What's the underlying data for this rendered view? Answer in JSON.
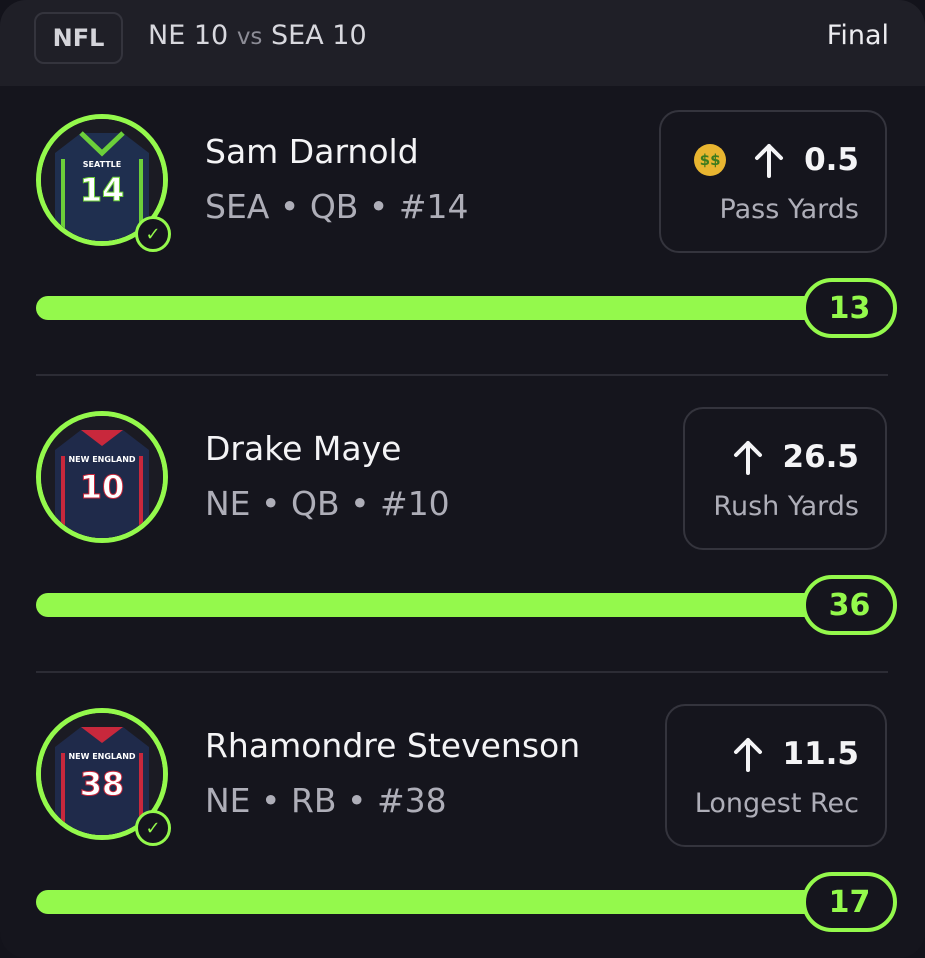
{
  "header": {
    "league": "NFL",
    "team_a": "NE",
    "score_a": "10",
    "vs": "vs",
    "team_b": "SEA",
    "score_b": "10",
    "status": "Final"
  },
  "colors": {
    "accent": "#94f94c",
    "background": "#15151d",
    "header_bg": "#1f1f27"
  },
  "players": [
    {
      "name": "Sam Darnold",
      "meta": "SEA • QB • #14",
      "jersey_team_text": "SEATTLE",
      "jersey_number": "14",
      "checked": true,
      "has_money_icon": true,
      "line_direction": "up",
      "line": "0.5",
      "stat_label": "Pass Yards",
      "actual": "13",
      "progress_percent": 100
    },
    {
      "name": "Drake Maye",
      "meta": "NE • QB • #10",
      "jersey_team_text": "NEW ENGLAND",
      "jersey_number": "10",
      "checked": false,
      "has_money_icon": false,
      "line_direction": "up",
      "line": "26.5",
      "stat_label": "Rush Yards",
      "actual": "36",
      "progress_percent": 100
    },
    {
      "name": "Rhamondre Stevenson",
      "meta": "NE • RB • #38",
      "jersey_team_text": "NEW ENGLAND",
      "jersey_number": "38",
      "checked": true,
      "has_money_icon": false,
      "line_direction": "up",
      "line": "11.5",
      "stat_label": "Longest Rec",
      "actual": "17",
      "progress_percent": 100
    }
  ]
}
